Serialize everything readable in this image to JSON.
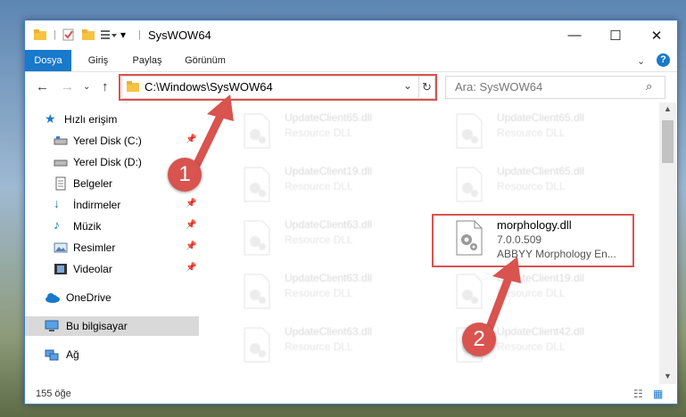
{
  "window": {
    "title": "SysWOW64"
  },
  "ribbon": {
    "tabs": [
      "Dosya",
      "Giriş",
      "Paylaş",
      "Görünüm"
    ]
  },
  "address": {
    "path": "C:\\Windows\\SysWOW64"
  },
  "search": {
    "placeholder": "Ara: SysWOW64"
  },
  "sidebar": {
    "items": [
      {
        "label": "Hızlı erişim",
        "icon": "star-icon"
      },
      {
        "label": "Yerel Disk (C:)",
        "icon": "drive-icon",
        "pinned": true
      },
      {
        "label": "Yerel Disk (D:)",
        "icon": "drive-icon"
      },
      {
        "label": "Belgeler",
        "icon": "document-icon",
        "pinned": true
      },
      {
        "label": "İndirmeler",
        "icon": "download-icon",
        "pinned": true
      },
      {
        "label": "Müzik",
        "icon": "music-icon",
        "pinned": true
      },
      {
        "label": "Resimler",
        "icon": "picture-icon",
        "pinned": true
      },
      {
        "label": "Videolar",
        "icon": "video-icon",
        "pinned": true
      },
      {
        "label": "OneDrive",
        "icon": "cloud-icon"
      },
      {
        "label": "Bu bilgisayar",
        "icon": "computer-icon",
        "selected": true
      },
      {
        "label": "Ağ",
        "icon": "network-icon"
      }
    ]
  },
  "files": {
    "col1": [
      {
        "name": "UpdateClient65.dll",
        "desc": "Resource DLL"
      },
      {
        "name": "UpdateClient19.dll",
        "desc": "Resource DLL"
      },
      {
        "name": "UpdateClient63.dll",
        "desc": "Resource DLL"
      },
      {
        "name": "UpdateClient63.dll",
        "desc": "Resource DLL"
      },
      {
        "name": "UpdateClient63.dll",
        "desc": "Resource DLL"
      }
    ],
    "col2": [
      {
        "name": "UpdateClient65.dll",
        "desc": "Resource DLL"
      },
      {
        "name": "UpdateClient65.dll",
        "desc": "Resource DLL"
      },
      {
        "name": "morphology.dll",
        "desc": "7.0.0.509",
        "desc2": "ABBYY Morphology En..."
      },
      {
        "name": "UpdateClient19.dll",
        "desc": "Resource DLL"
      },
      {
        "name": "UpdateClient42.dll",
        "desc": "Resource DLL"
      }
    ]
  },
  "status": {
    "count": "155 öğe"
  },
  "badges": {
    "one": "1",
    "two": "2"
  },
  "colors": {
    "accent": "#1979ca",
    "highlight": "#d9534f"
  }
}
